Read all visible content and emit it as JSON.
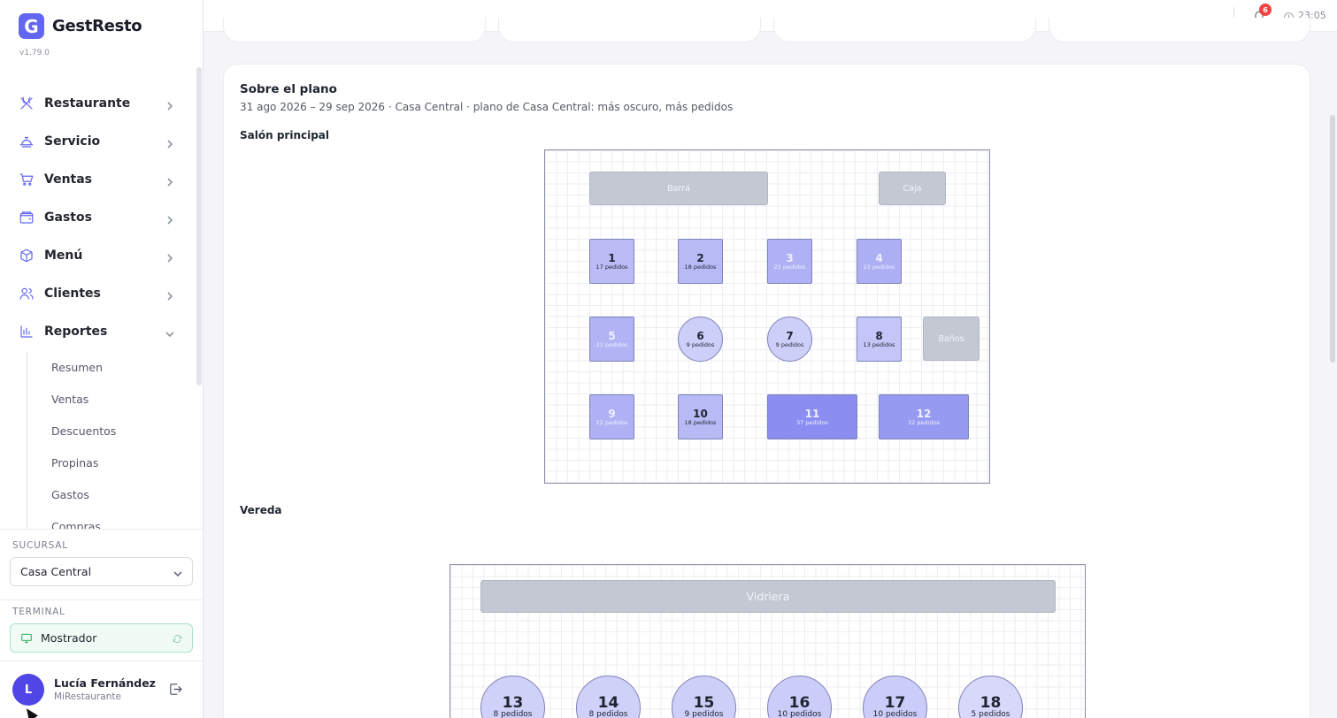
{
  "app": {
    "logo_letter": "G",
    "name": "GestResto",
    "version": "v1.79.0"
  },
  "nav": {
    "items": [
      {
        "label": "Restaurante",
        "icon": "utensils-icon"
      },
      {
        "label": "Servicio",
        "icon": "cloche-icon"
      },
      {
        "label": "Ventas",
        "icon": "cart-icon"
      },
      {
        "label": "Gastos",
        "icon": "wallet-icon"
      },
      {
        "label": "Menú",
        "icon": "box-icon"
      },
      {
        "label": "Clientes",
        "icon": "users-icon"
      },
      {
        "label": "Reportes",
        "icon": "bar-chart-icon"
      }
    ],
    "reportes_sub": [
      "Resumen",
      "Ventas",
      "Descuentos",
      "Propinas",
      "Gastos",
      "Compras"
    ]
  },
  "sucursal": {
    "label": "SUCURSAL",
    "value": "Casa Central"
  },
  "terminal": {
    "label": "TERMINAL",
    "value": "Mostrador"
  },
  "user": {
    "initial": "L",
    "name": "Lucía Fernández",
    "org": "MiRestaurante"
  },
  "topbar": {
    "notifications": "6",
    "time": "23:05"
  },
  "panel": {
    "title": "Sobre el plano",
    "subtitle": "31 ago 2026 – 29 sep 2026 · Casa Central · plano de Casa Central: más oscuro, más pedidos"
  },
  "areas": [
    {
      "name": "Salón principal",
      "fixtures": [
        "Barra",
        "Caja",
        "Baños"
      ],
      "tables": [
        {
          "num": "1",
          "orders": "17 pedidos",
          "count": 17
        },
        {
          "num": "2",
          "orders": "18 pedidos",
          "count": 18
        },
        {
          "num": "3",
          "orders": "22 pedidos",
          "count": 22
        },
        {
          "num": "4",
          "orders": "23 pedidos",
          "count": 23
        },
        {
          "num": "5",
          "orders": "21 pedidos",
          "count": 21
        },
        {
          "num": "6",
          "orders": "9 pedidos",
          "count": 9
        },
        {
          "num": "7",
          "orders": "9 pedidos",
          "count": 9
        },
        {
          "num": "8",
          "orders": "13 pedidos",
          "count": 13
        },
        {
          "num": "9",
          "orders": "22 pedidos",
          "count": 22
        },
        {
          "num": "10",
          "orders": "18 pedidos",
          "count": 18
        },
        {
          "num": "11",
          "orders": "37 pedidos",
          "count": 37
        },
        {
          "num": "12",
          "orders": "32 pedidos",
          "count": 32
        }
      ]
    },
    {
      "name": "Vereda",
      "fixtures": [
        "Vidriera"
      ],
      "tables": [
        {
          "num": "13",
          "orders": "8 pedidos",
          "count": 8
        },
        {
          "num": "14",
          "orders": "8 pedidos",
          "count": 8
        },
        {
          "num": "15",
          "orders": "9 pedidos",
          "count": 9
        },
        {
          "num": "16",
          "orders": "10 pedidos",
          "count": 10
        },
        {
          "num": "17",
          "orders": "10 pedidos",
          "count": 10
        },
        {
          "num": "18",
          "orders": "5 pedidos",
          "count": 5
        }
      ]
    }
  ],
  "colors": {
    "accent": "#6366f1",
    "heat_low": "#e3e4fb",
    "heat_high": "#8b8ef0"
  }
}
